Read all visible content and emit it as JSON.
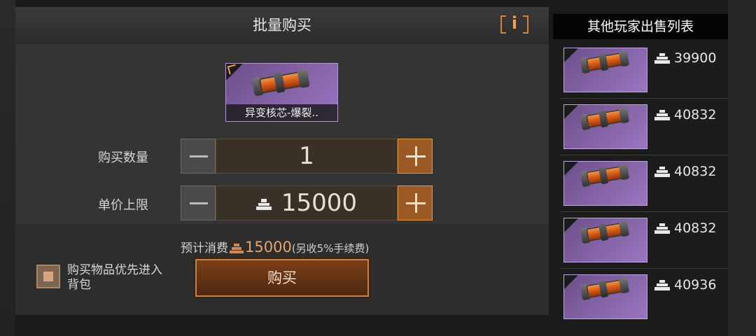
{
  "panel": {
    "title": "批量购买",
    "info_label": "i",
    "item": {
      "name": "异变核芯-爆裂.."
    },
    "quantity": {
      "label": "购买数量",
      "value": "1"
    },
    "price_cap": {
      "label": "单价上限",
      "value": "15000"
    },
    "cost": {
      "prefix": "预计消费",
      "amount": "15000",
      "note": "(另收5%手续费)"
    },
    "priority_checkbox": {
      "label": "购买物品优先进入背包",
      "checked": true
    },
    "buy_label": "购买"
  },
  "listing": {
    "title": "其他玩家出售列表",
    "items": [
      {
        "price": "39900"
      },
      {
        "price": "40832"
      },
      {
        "price": "40832"
      },
      {
        "price": "40832"
      },
      {
        "price": "40936"
      }
    ]
  },
  "icons": [
    "info-icon",
    "minus-icon",
    "plus-icon",
    "currency-icon",
    "checkbox-icon",
    "item-core-icon"
  ],
  "colors": {
    "accent": "#d58232",
    "item_rarity": "#9a76c0",
    "panel_bg": "#343434"
  }
}
